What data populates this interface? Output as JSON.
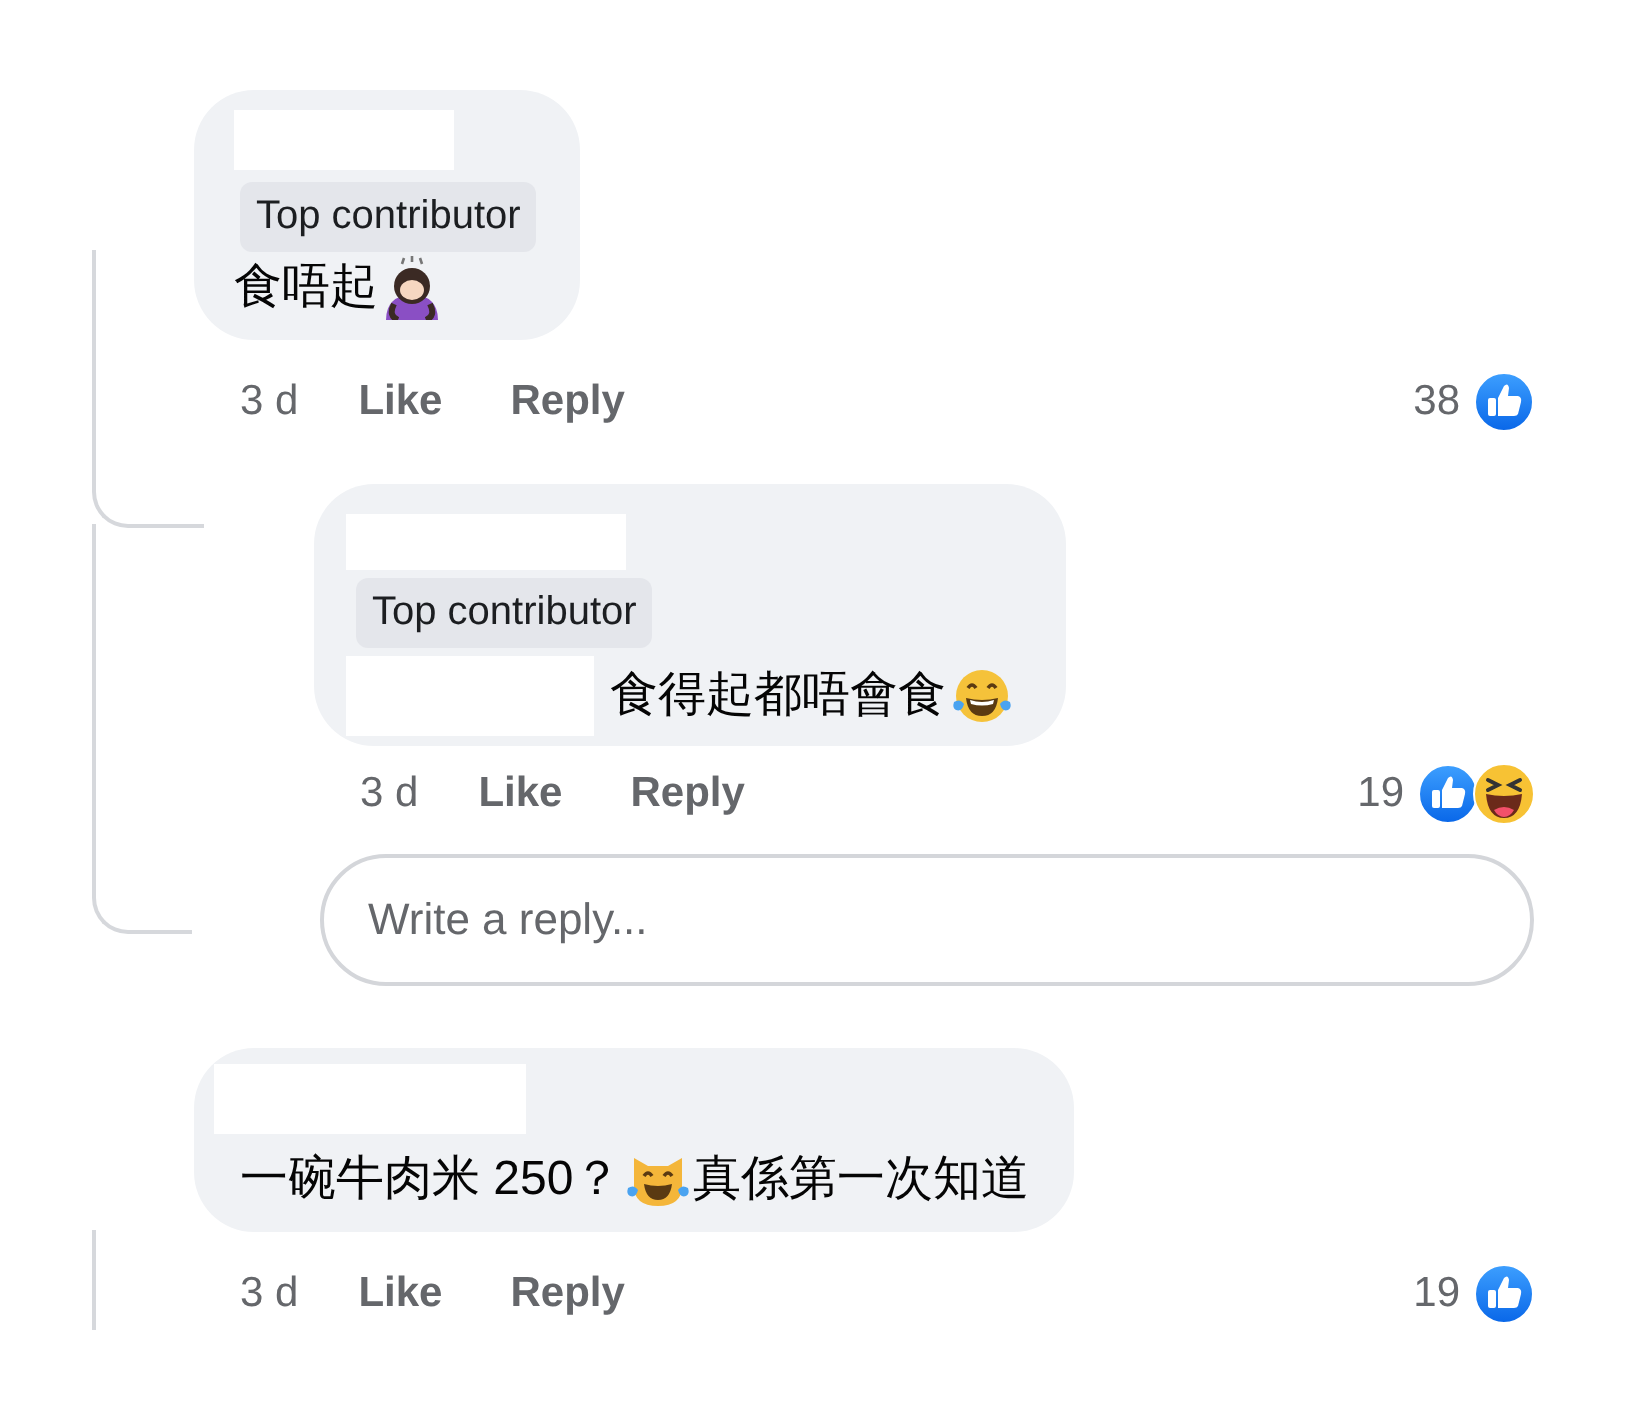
{
  "comments": [
    {
      "badge": "Top contributor",
      "message": [
        {
          "kind": "text",
          "text": "食唔起"
        },
        {
          "kind": "bowing"
        }
      ],
      "time": "3 d",
      "actions": [
        "Like",
        "Reply"
      ],
      "reaction_count": "38",
      "reactions": [
        {
          "kind": "like"
        }
      ],
      "replies": [
        {
          "badge": "Top contributor",
          "message": [
            {
              "kind": "blank"
            },
            {
              "kind": "text",
              "text": "食得起都唔會食"
            },
            {
              "kind": "laughing"
            }
          ],
          "time": "3 d",
          "actions": [
            "Like",
            "Reply"
          ],
          "reaction_count": "19",
          "reactions": [
            {
              "kind": "like"
            },
            {
              "kind": "haha"
            }
          ]
        }
      ],
      "reply_box": {
        "placeholder": "Write a reply..."
      }
    },
    {
      "message": [
        {
          "kind": "text",
          "text": "一碗牛肉米 250？"
        },
        {
          "kind": "cat"
        },
        {
          "kind": "text",
          "text": "真係第一次知道"
        }
      ],
      "time": "3 d",
      "actions": [
        "Like",
        "Reply"
      ],
      "reaction_count": "19",
      "reactions": [
        {
          "kind": "like"
        }
      ]
    }
  ]
}
